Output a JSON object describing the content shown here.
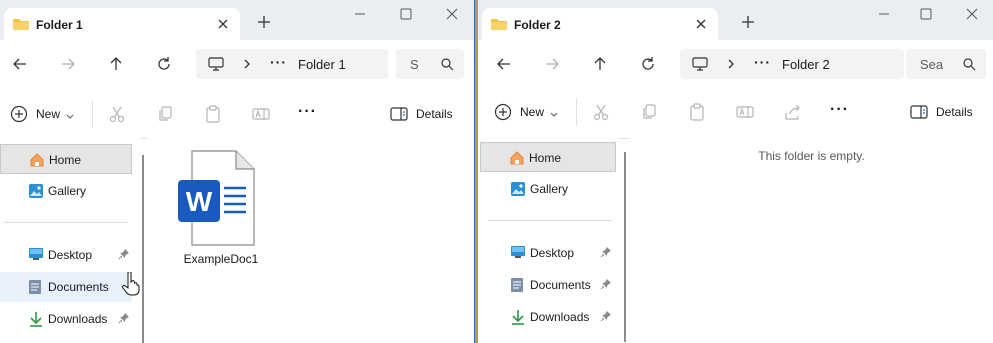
{
  "window1": {
    "tab_title": "Folder 1",
    "breadcrumb": "Folder 1",
    "search_placeholder": "S",
    "overflow_label": "···",
    "new_label": "New",
    "details_label": "Details",
    "nav": {
      "home": "Home",
      "gallery": "Gallery",
      "desktop": "Desktop",
      "documents": "Documents",
      "downloads": "Downloads"
    },
    "files": [
      {
        "name": "ExampleDoc1",
        "icon": "word-document-icon"
      }
    ]
  },
  "window2": {
    "tab_title": "Folder 2",
    "breadcrumb": "Folder 2",
    "search_placeholder": "Sea",
    "overflow_label": "···",
    "new_label": "New",
    "details_label": "Details",
    "empty_message": "This folder is empty.",
    "nav": {
      "home": "Home",
      "gallery": "Gallery",
      "desktop": "Desktop",
      "documents": "Documents",
      "downloads": "Downloads"
    }
  },
  "colors": {
    "folder_yellow": "#f5c242",
    "word_blue": "#185abd",
    "home_orange": "#e8823a",
    "desktop_blue": "#2b8fd6",
    "download_green": "#2d9a4a",
    "accent_border": "#2a6fb0"
  }
}
